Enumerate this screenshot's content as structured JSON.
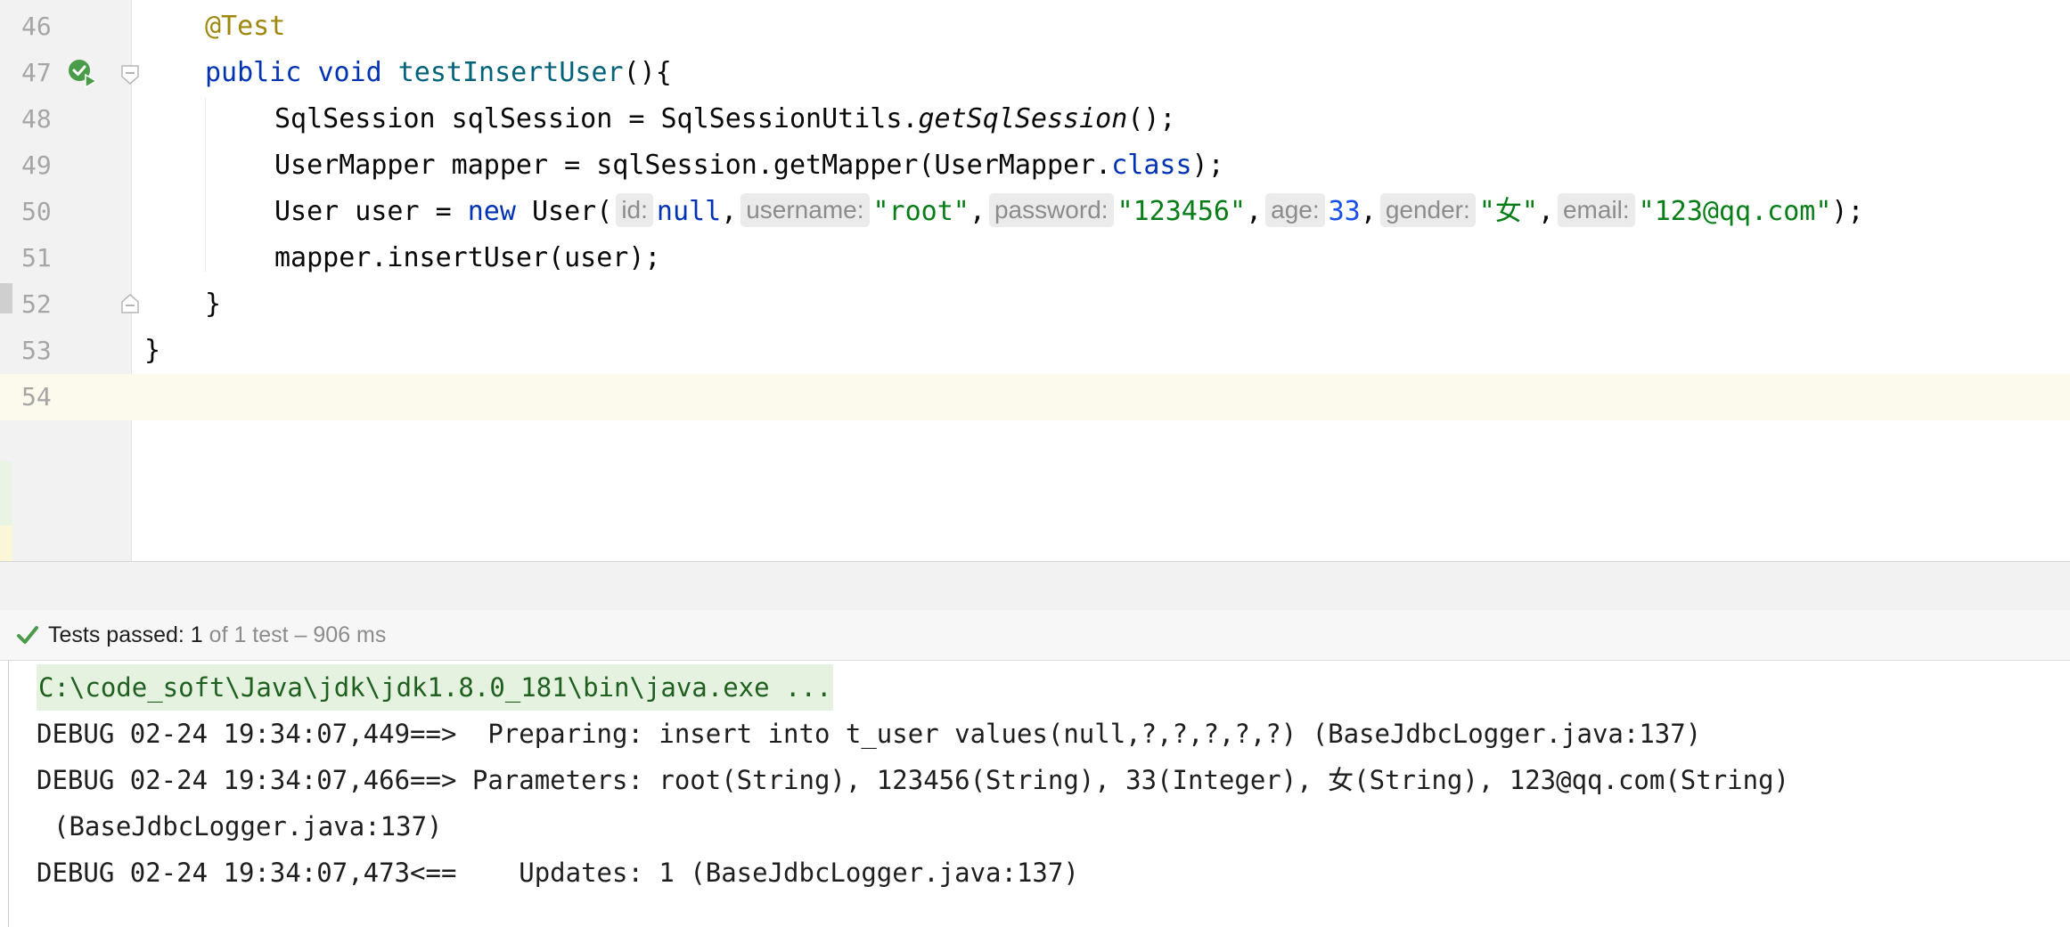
{
  "editor": {
    "lines": [
      {
        "number": "46",
        "tokens": [
          [
            "ann",
            "@Test"
          ]
        ]
      },
      {
        "number": "47",
        "tokens": [
          [
            "kw",
            "public"
          ],
          [
            "plain",
            " "
          ],
          [
            "kw",
            "void"
          ],
          [
            "plain",
            " "
          ],
          [
            "fn",
            "testInsertUser"
          ],
          [
            "plain",
            "(){"
          ]
        ]
      },
      {
        "number": "48",
        "tokens": [
          [
            "plain",
            "SqlSession sqlSession = SqlSessionUtils."
          ],
          [
            "it",
            "getSqlSession"
          ],
          [
            "plain",
            "();"
          ]
        ]
      },
      {
        "number": "49",
        "tokens": [
          [
            "plain",
            "UserMapper mapper = sqlSession.getMapper(UserMapper."
          ],
          [
            "kw",
            "class"
          ],
          [
            "plain",
            ");"
          ]
        ]
      },
      {
        "number": "50",
        "tokens": [
          [
            "plain",
            "User user = "
          ],
          [
            "kw",
            "new"
          ],
          [
            "plain",
            " User("
          ],
          [
            "hint",
            "id:"
          ],
          [
            "kw",
            "null"
          ],
          [
            "plain",
            ","
          ],
          [
            "hint",
            "username:"
          ],
          [
            "str",
            "\"root\""
          ],
          [
            "plain",
            ","
          ],
          [
            "hint",
            "password:"
          ],
          [
            "str",
            "\"123456\""
          ],
          [
            "plain",
            ","
          ],
          [
            "hint",
            "age:"
          ],
          [
            "num",
            "33"
          ],
          [
            "plain",
            ","
          ],
          [
            "hint",
            "gender:"
          ],
          [
            "str",
            "\"女\""
          ],
          [
            "plain",
            ","
          ],
          [
            "hint",
            "email:"
          ],
          [
            "str",
            "\"123@qq.com\""
          ],
          [
            "plain",
            ");"
          ]
        ]
      },
      {
        "number": "51",
        "tokens": [
          [
            "plain",
            "mapper.insertUser(user);"
          ]
        ]
      },
      {
        "number": "52",
        "tokens": [
          [
            "plain",
            "}"
          ]
        ]
      },
      {
        "number": "53",
        "tokens": [
          [
            "plain",
            "}"
          ]
        ]
      },
      {
        "number": "54",
        "tokens": []
      }
    ]
  },
  "test_status": {
    "icon": "check-icon",
    "passed_label": "Tests passed: 1",
    "detail": " of 1 test – 906 ms",
    "color": "#4a9b4a"
  },
  "console": {
    "command": "C:\\code_soft\\Java\\jdk\\jdk1.8.0_181\\bin\\java.exe ...",
    "lines": [
      "DEBUG 02-24 19:34:07,449==>  Preparing: insert into t_user values(null,?,?,?,?,?) (BaseJdbcLogger.java:137)",
      "DEBUG 02-24 19:34:07,466==> Parameters: root(String), 123456(String), 33(Integer), 女(String), 123@qq.com(String)",
      "(BaseJdbcLogger.java:137)",
      "DEBUG 02-24 19:34:07,473<==    Updates: 1 (BaseJdbcLogger.java:137)"
    ]
  },
  "colors": {
    "annotation": "#9e880d",
    "keyword": "#0033b3",
    "function": "#00627a",
    "string": "#067d17",
    "number": "#1750eb",
    "current_line": "#fcfaed"
  }
}
